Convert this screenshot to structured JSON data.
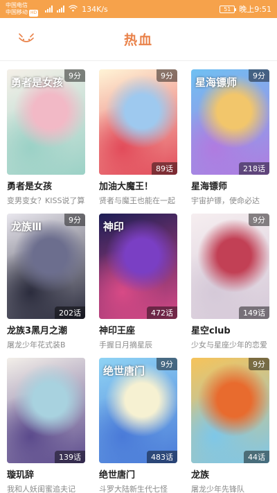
{
  "status_bar": {
    "carrier1": "中国电信",
    "carrier2": "中国移动",
    "hd_badge": "HD",
    "net_speed": "134K/s",
    "battery": "51",
    "time": "晚上9:51"
  },
  "header": {
    "title": "热血",
    "menu_icon": "cat-menu-icon"
  },
  "comics": [
    {
      "title": "勇者是女孩",
      "desc": "变男变女？KISS说了算",
      "score": "9分",
      "chapters": "",
      "logo": "勇者是女孩",
      "colors": [
        "#f5f0e8",
        "#f2b9c6",
        "#9bd1c6"
      ]
    },
    {
      "title": "加油大魔王！",
      "desc": "贤者与魔王也能在一起",
      "score": "9分",
      "chapters": "89话",
      "logo": "",
      "colors": [
        "#fff4d6",
        "#9ec9ef",
        "#e24b5a"
      ]
    },
    {
      "title": "星海镖师",
      "desc": "宇宙护镖，使命必达",
      "score": "9分",
      "chapters": "218话",
      "logo": "星海镖师",
      "colors": [
        "#6fc0f2",
        "#f2c66b",
        "#b07be0"
      ]
    },
    {
      "title": "龙族3黑月之潮",
      "desc": "屠龙少年花式装B",
      "score": "9分",
      "chapters": "202话",
      "logo": "龙族Ⅲ",
      "colors": [
        "#e9e7ee",
        "#6c6e8e",
        "#2b2c3d"
      ]
    },
    {
      "title": "神印王座",
      "desc": "手握日月摘星辰",
      "score": "",
      "chapters": "472话",
      "logo": "神印",
      "colors": [
        "#1d1e55",
        "#7a3fc4",
        "#d84a86"
      ]
    },
    {
      "title": "星空club",
      "desc": "少女与星座少年的恋爱",
      "score": "9分",
      "chapters": "149话",
      "logo": "",
      "colors": [
        "#f6eef0",
        "#c24055",
        "#d5c9d8"
      ]
    },
    {
      "title": "璇玑辞",
      "desc": "我和人妖闺蜜追夫记",
      "score": "",
      "chapters": "139话",
      "logo": "",
      "colors": [
        "#f3efe9",
        "#a8d2df",
        "#5b4a8c"
      ]
    },
    {
      "title": "绝世唐门",
      "desc": "斗罗大陆新生代七怪",
      "score": "9分",
      "chapters": "483话",
      "logo": "绝世唐门",
      "colors": [
        "#8fd3f4",
        "#f6f1d2",
        "#4a7ad8"
      ]
    },
    {
      "title": "龙族",
      "desc": "屠龙少年先锋队",
      "score": "9分",
      "chapters": "44话",
      "logo": "",
      "colors": [
        "#f6c35a",
        "#e86b2e",
        "#7ec7e8"
      ]
    }
  ]
}
